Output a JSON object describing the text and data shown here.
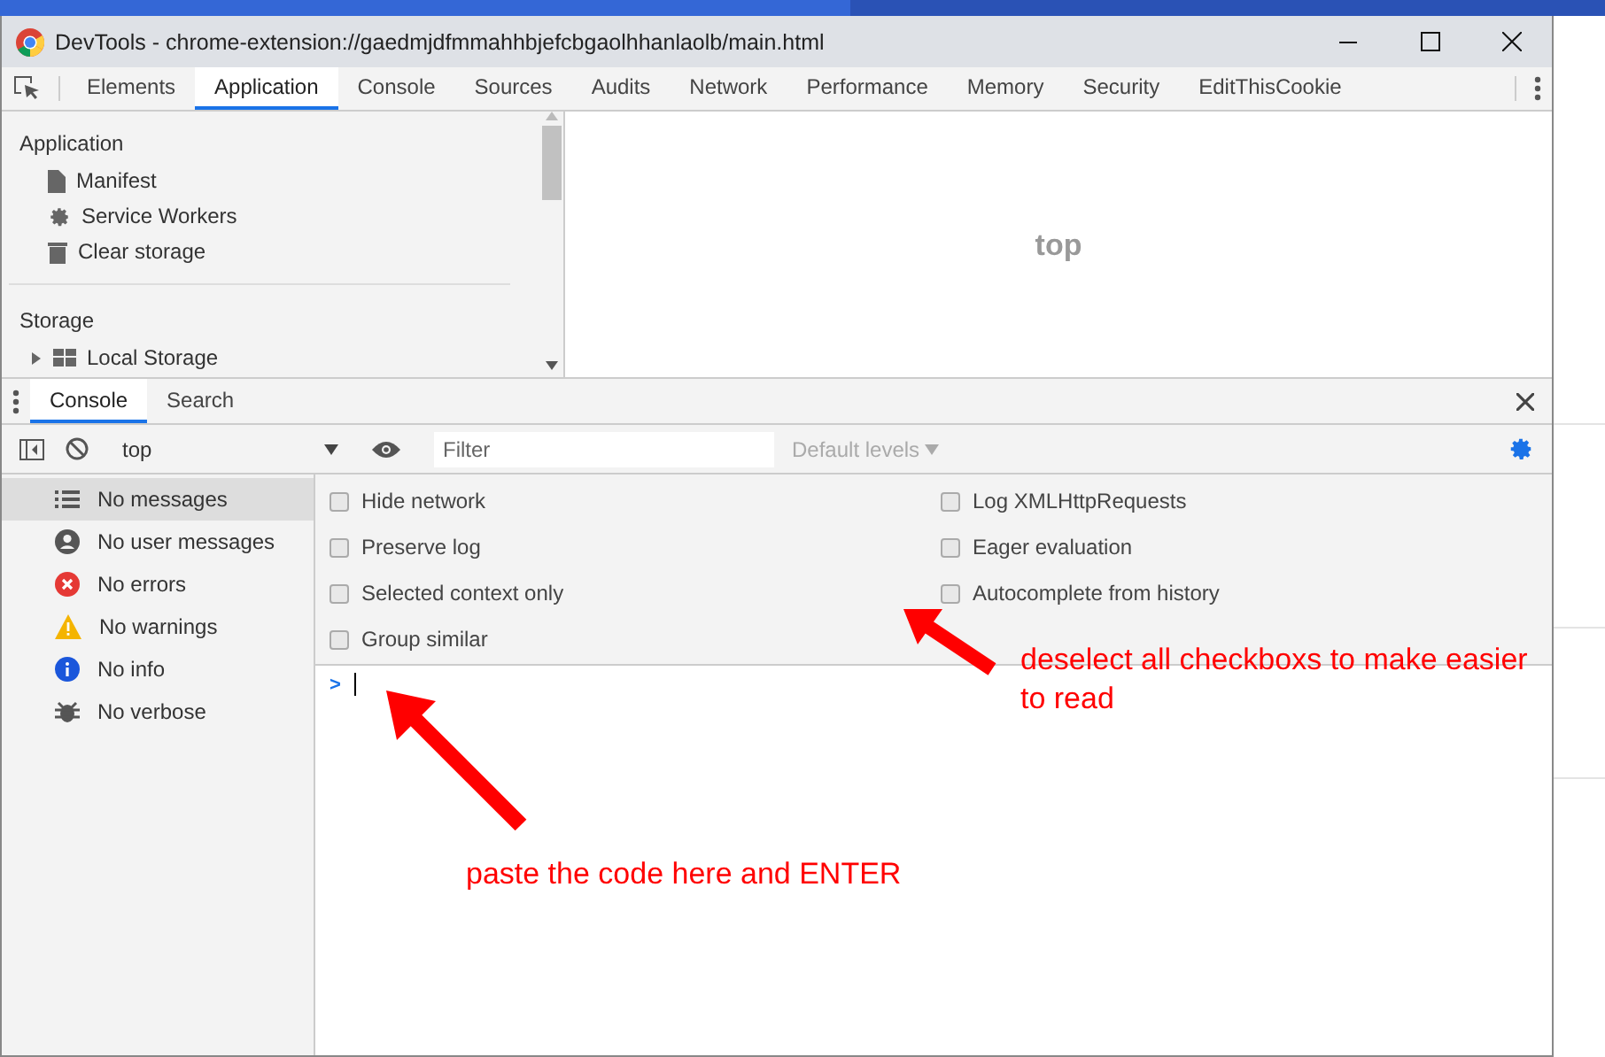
{
  "window": {
    "title": "DevTools - chrome-extension://gaedmjdfmmahhbjefcbgaolhhanlaolb/main.html"
  },
  "tabs": [
    {
      "label": "Elements",
      "selected": false
    },
    {
      "label": "Application",
      "selected": true
    },
    {
      "label": "Console",
      "selected": false
    },
    {
      "label": "Sources",
      "selected": false
    },
    {
      "label": "Audits",
      "selected": false
    },
    {
      "label": "Network",
      "selected": false
    },
    {
      "label": "Performance",
      "selected": false
    },
    {
      "label": "Memory",
      "selected": false
    },
    {
      "label": "Security",
      "selected": false
    },
    {
      "label": "EditThisCookie",
      "selected": false
    }
  ],
  "application_sidebar": [
    {
      "heading": "Application",
      "items": [
        {
          "label": "Manifest",
          "kind": "file"
        },
        {
          "label": "Service Workers",
          "kind": "gear"
        },
        {
          "label": "Clear storage",
          "kind": "trash"
        }
      ]
    },
    {
      "heading": "Storage",
      "items": [
        {
          "label": "Local Storage",
          "kind": "grid",
          "expanded": false
        }
      ]
    }
  ],
  "frame_preview": {
    "label": "top"
  },
  "drawer_tabs": [
    {
      "label": "Console",
      "selected": true
    },
    {
      "label": "Search",
      "selected": false
    }
  ],
  "console_toolbar": {
    "context": "top",
    "filter": {
      "placeholder": "Filter"
    },
    "levels": "Default levels"
  },
  "message_filters": [
    {
      "label": "No messages",
      "kind": "list",
      "selected": true
    },
    {
      "label": "No user messages",
      "kind": "user",
      "selected": false
    },
    {
      "label": "No errors",
      "kind": "error",
      "selected": false
    },
    {
      "label": "No warnings",
      "kind": "warning",
      "selected": false
    },
    {
      "label": "No info",
      "kind": "info",
      "selected": false
    },
    {
      "label": "No verbose",
      "kind": "bug",
      "selected": false
    }
  ],
  "settings_left": [
    {
      "label": "Hide network",
      "checked": false
    },
    {
      "label": "Preserve log",
      "checked": false
    },
    {
      "label": "Selected context only",
      "checked": false
    },
    {
      "label": "Group similar",
      "checked": false
    }
  ],
  "settings_right": [
    {
      "label": "Log XMLHttpRequests",
      "checked": false
    },
    {
      "label": "Eager evaluation",
      "checked": false
    },
    {
      "label": "Autocomplete from history",
      "checked": false
    }
  ],
  "prompt": {
    "symbol": ">"
  },
  "annotations": [
    {
      "text": "deselect all checkboxs to make easier to read"
    },
    {
      "text": "paste the code here and ENTER"
    }
  ]
}
